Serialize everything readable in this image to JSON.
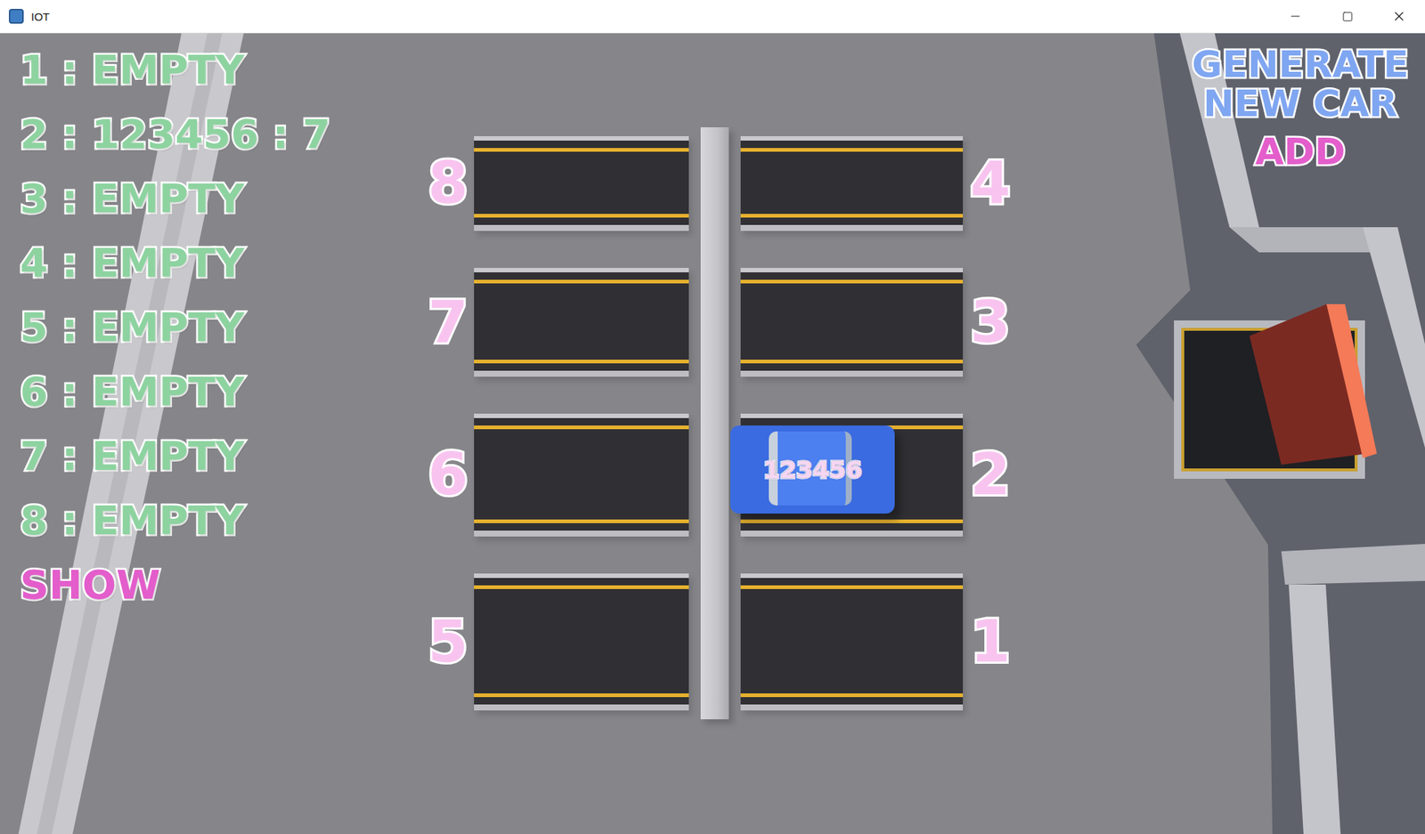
{
  "window": {
    "title": "IOT"
  },
  "slot_status": [
    {
      "label": "1 : EMPTY"
    },
    {
      "label": "2 : 123456 : 7"
    },
    {
      "label": "3 : EMPTY"
    },
    {
      "label": "4 : EMPTY"
    },
    {
      "label": "5 : EMPTY"
    },
    {
      "label": "6 : EMPTY"
    },
    {
      "label": "7 : EMPTY"
    },
    {
      "label": "8 : EMPTY"
    }
  ],
  "show_button": "SHOW",
  "generate": {
    "lines": [
      "GENERATE",
      "NEW CAR"
    ],
    "add_button": "ADD"
  },
  "parking_spots": [
    {
      "number": "8",
      "occupied": false
    },
    {
      "number": "4",
      "occupied": false
    },
    {
      "number": "7",
      "occupied": false
    },
    {
      "number": "3",
      "occupied": false
    },
    {
      "number": "6",
      "occupied": false
    },
    {
      "number": "2",
      "occupied": true,
      "car": {
        "plate": "123456"
      }
    },
    {
      "number": "5",
      "occupied": false
    },
    {
      "number": "1",
      "occupied": false
    }
  ]
}
